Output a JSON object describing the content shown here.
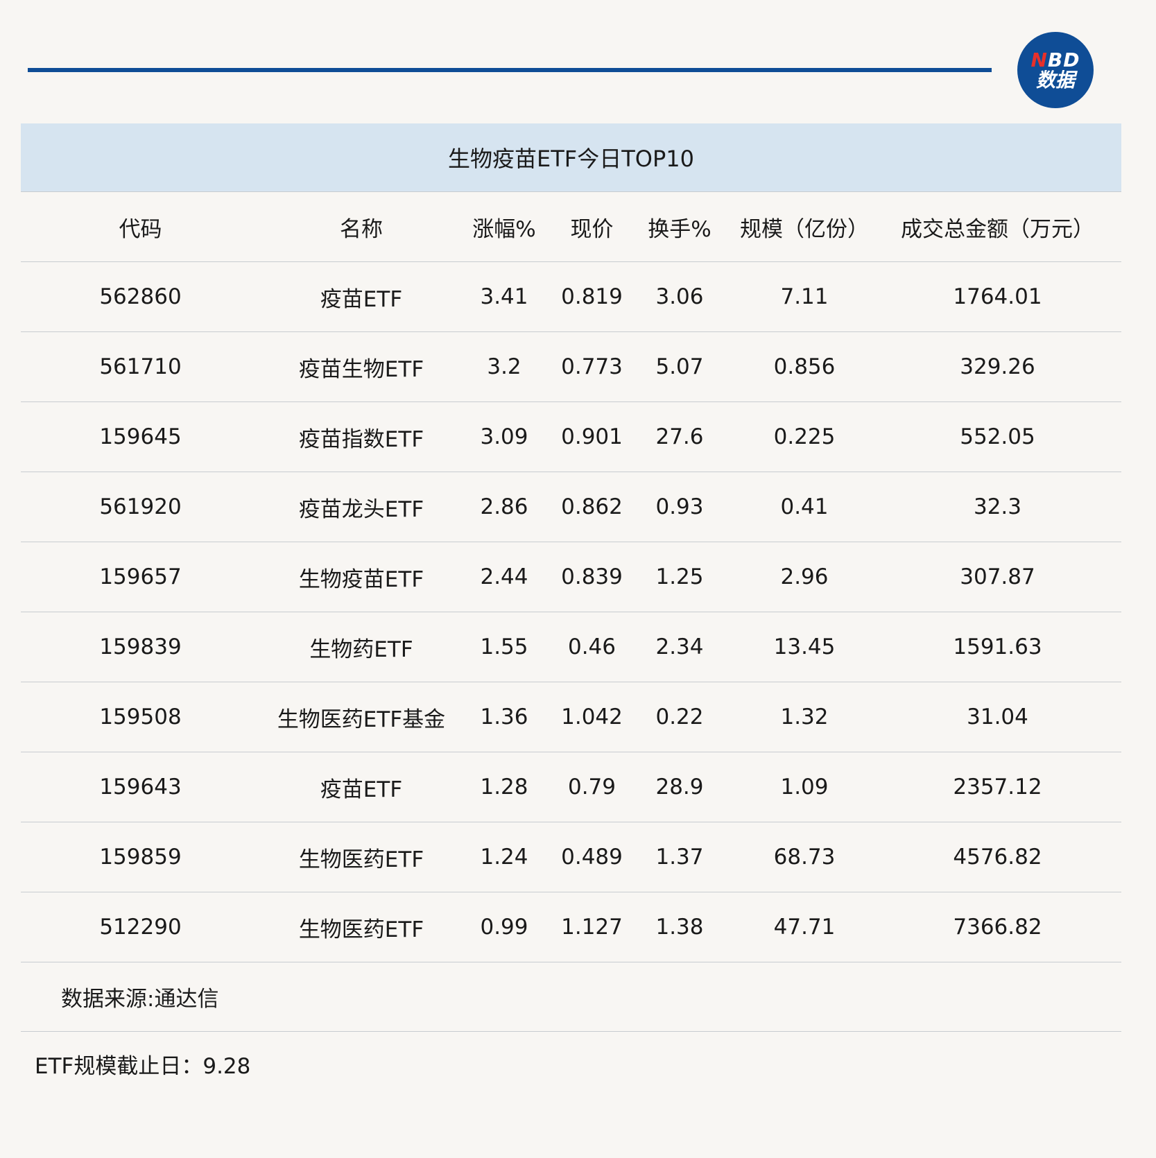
{
  "logo": {
    "top_red": "N",
    "top_white": "BD",
    "bottom": "数据"
  },
  "table": {
    "title": "生物疫苗ETF今日TOP10",
    "headers": [
      "代码",
      "名称",
      "涨幅%",
      "现价",
      "换手%",
      "规模（亿份）",
      "成交总金额（万元）"
    ],
    "rows": [
      [
        "562860",
        "疫苗ETF",
        "3.41",
        "0.819",
        "3.06",
        "7.11",
        "1764.01"
      ],
      [
        "561710",
        "疫苗生物ETF",
        "3.2",
        "0.773",
        "5.07",
        "0.856",
        "329.26"
      ],
      [
        "159645",
        "疫苗指数ETF",
        "3.09",
        "0.901",
        "27.6",
        "0.225",
        "552.05"
      ],
      [
        "561920",
        "疫苗龙头ETF",
        "2.86",
        "0.862",
        "0.93",
        "0.41",
        "32.3"
      ],
      [
        "159657",
        "生物疫苗ETF",
        "2.44",
        "0.839",
        "1.25",
        "2.96",
        "307.87"
      ],
      [
        "159839",
        "生物药ETF",
        "1.55",
        "0.46",
        "2.34",
        "13.45",
        "1591.63"
      ],
      [
        "159508",
        "生物医药ETF基金",
        "1.36",
        "1.042",
        "0.22",
        "1.32",
        "31.04"
      ],
      [
        "159643",
        "疫苗ETF",
        "1.28",
        "0.79",
        "28.9",
        "1.09",
        "2357.12"
      ],
      [
        "159859",
        "生物医药ETF",
        "1.24",
        "0.489",
        "1.37",
        "68.73",
        "4576.82"
      ],
      [
        "512290",
        "生物医药ETF",
        "0.99",
        "1.127",
        "1.38",
        "47.71",
        "7366.82"
      ]
    ],
    "source": "数据来源:通达信"
  },
  "footnote": "ETF规模截止日：9.28",
  "colors": {
    "accent": "#0f4d96",
    "title_bg": "#d6e4f0",
    "logo_red": "#e8302a"
  }
}
